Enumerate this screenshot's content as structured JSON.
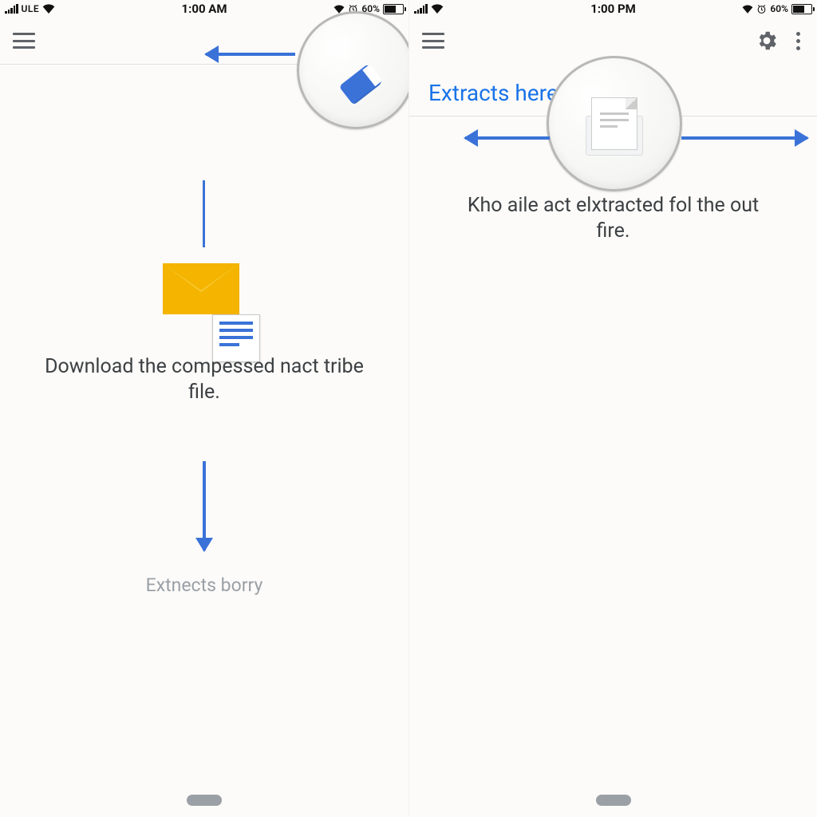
{
  "screens": [
    {
      "status": {
        "carrier": "ULE",
        "time": "1:00 AM",
        "battery_pct": "60%"
      },
      "body_text": "Download the compessed nact tribe file.",
      "footer_label": "Extnects borry"
    },
    {
      "status": {
        "carrier": "",
        "time": "1:00 PM",
        "battery_pct": "60%"
      },
      "section_title": "Extracts here",
      "body_text": "Kho aile act elxtracted fol the out fire."
    }
  ]
}
